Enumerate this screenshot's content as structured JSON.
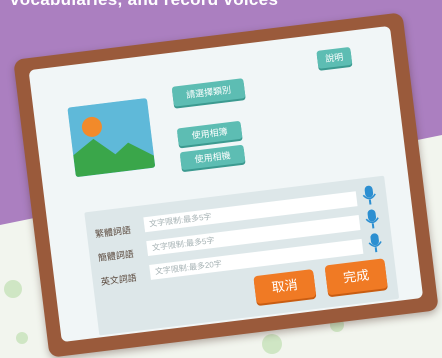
{
  "caption": "vocabularies, and record voices",
  "app": {
    "help_button": "說明",
    "choose_image_button": "請選擇類別",
    "use_album_button": "使用相簿",
    "use_camera_button": "使用相機",
    "rows": [
      {
        "label": "繁體詞語",
        "placeholder": "文字限制:最多5字"
      },
      {
        "label": "簡體詞語",
        "placeholder": "文字限制:最多5字"
      },
      {
        "label": "英文詞語",
        "placeholder": "文字限制:最多20字"
      }
    ],
    "cancel_button": "取消",
    "done_button": "完成"
  },
  "colors": {
    "purple": "#ab7fc0",
    "frame": "#9a5a3b",
    "teal_button": "#5dbdb3",
    "orange_button": "#f07a24",
    "mic_blue": "#2c8fd1"
  }
}
